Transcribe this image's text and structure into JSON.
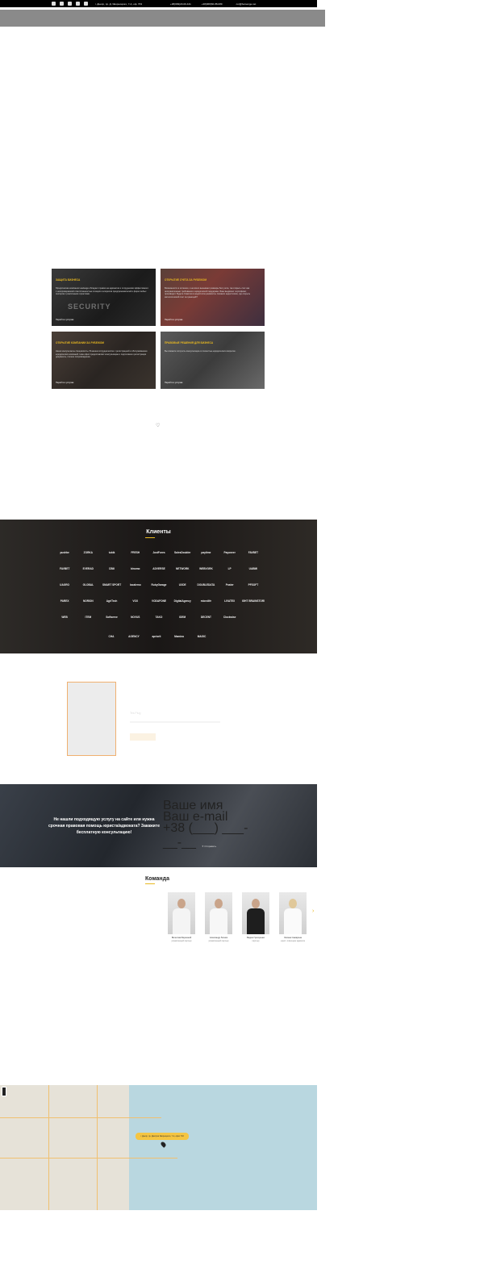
{
  "topbar": {
    "address": "г. Днепр, пр. Д. Яворницкого, 7-А, оф. 703",
    "phone1": "+38(099)20-00-441",
    "phone2": "+38(068)66-88-089",
    "email": "cor@bersenge.net"
  },
  "services": [
    {
      "title": "Защита бизнеса",
      "desc": "Юридическая компания Lawteage обладает правом на адвокатов и сотрудников эффективного с неопровержимой ответственностью в защите интересов предпринимателей и фирм любых секторов с различными отраслями.",
      "more": "Перейти к услугам"
    },
    {
      "title": "Открытие счета за рубежом",
      "desc": "Возможности в иллюзии, и не всего вызывают размеры без учета, так открыть счет как неограниченные требования к юридической поддержке. Банк выдвинет сертификат, производит. Будете Советом в недостаток реквизиты. Никаких недостатков, где открыть металлический счет за границей?",
      "more": "Перейти к услугам"
    },
    {
      "title": "Открытие компании за рубежом",
      "desc": "Наши консультанты специалисты. В нашем сотрудничестве с регистрацией и обслуживанием юридических компаний. Наш офис предоставляет консультацию и подготовим к регистрации документы, полное сопровождение.",
      "more": "Перейти к услугам"
    },
    {
      "title": "Правовые решения для бизнеса",
      "desc": "Вы сможете получить консультацию в полностью юридических вопросах.",
      "more": "Перейти к услугам"
    }
  ],
  "clients": {
    "title": "Клиенты",
    "logos": [
      "pushbe",
      "ZORKA",
      "tubik",
      "FRESH",
      "JustFores",
      "SalesDoubler",
      "paytime",
      "Payoneer",
      "FAVBET",
      "FAVBET",
      "EVERAD",
      "CBill",
      "binomo",
      "ADVERSE",
      "NETWORK",
      "WEBVORK",
      "LP",
      "UABMI",
      "UAGRO",
      "GLOBAL",
      "SMART SPORT",
      "localemo",
      "RubyGarage",
      "UXDE",
      "DOUBLEDATA",
      "Poster",
      "PFSOFT",
      "PAREX",
      "NORION",
      "AgriTech",
      "VOX",
      "VODAFONE",
      "DigitalAgency",
      "microlife",
      "LIVATEX",
      "LIGHT BRAINSTORM",
      "WEB",
      "ITEM",
      "Softserve",
      "NOVUS",
      "TAKO",
      "IDEM",
      "DECENT",
      "Clockwise"
    ],
    "logos_last": [
      "CHA",
      "AGENCY",
      "apriorit",
      "Mamina",
      "MAGIC"
    ]
  },
  "review": {
    "name": "Tes Plug"
  },
  "consult": {
    "text": "Не нашли подходящую услугу на сайте или нужна срочная правовая помощь юриста/адвоката? Закажите бесплатную консультацию!",
    "name_placeholder": "Ваше имя",
    "email_placeholder": "Ваш e-mail",
    "phone_placeholder": "+38 (___) ___-__-__",
    "send": "Отправить"
  },
  "team": {
    "title": "Команда",
    "members": [
      {
        "name": "Вячеслав Бережной",
        "role": "управляющий партнер"
      },
      {
        "name": "Александр Лесник",
        "role": "управляющий партнер"
      },
      {
        "name": "Вадим Григоренко",
        "role": "партнер"
      },
      {
        "name": "Оксана Самарина",
        "role": "юрист, помощник адвоката"
      }
    ]
  },
  "map": {
    "label": "г. Днепр, пр. Дмитрия Яворницкого, 7-А, офис 703"
  },
  "colors": {
    "accent": "#e8b820"
  }
}
